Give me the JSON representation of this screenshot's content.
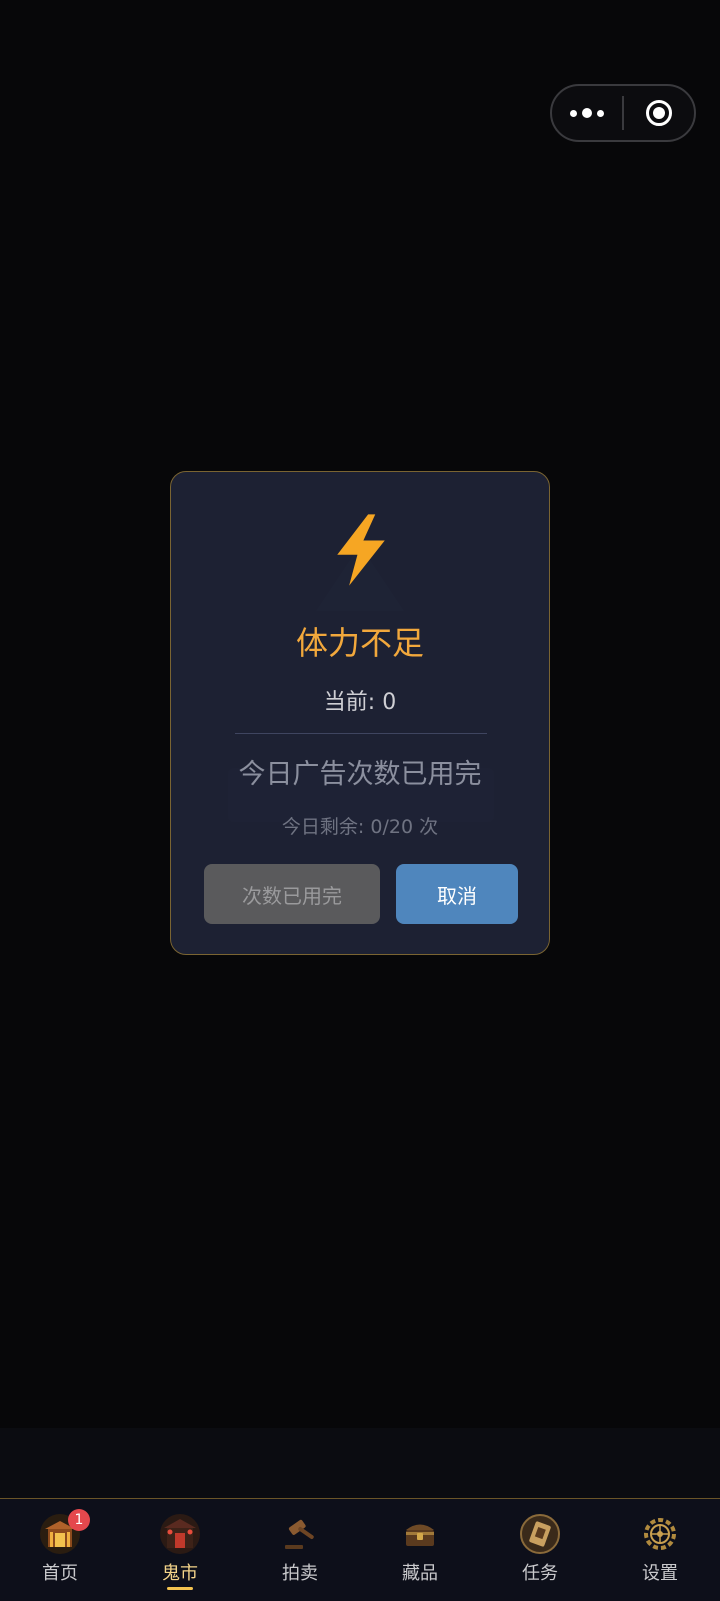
{
  "modal": {
    "title": "体力不足",
    "current": "当前: 0",
    "message": "今日广告次数已用完",
    "remaining": "今日剩余: 0/20 次",
    "used_button": "次数已用完",
    "cancel_button": "取消"
  },
  "tabs": [
    {
      "label": "首页",
      "icon": "gate-icon",
      "badge": "1"
    },
    {
      "label": "鬼市",
      "icon": "market-icon",
      "active": true
    },
    {
      "label": "拍卖",
      "icon": "gavel-icon"
    },
    {
      "label": "藏品",
      "icon": "chest-icon"
    },
    {
      "label": "任务",
      "icon": "scroll-icon"
    },
    {
      "label": "设置",
      "icon": "gear-icon"
    }
  ],
  "colors": {
    "accent": "#f2a83c",
    "cancel": "#4f86bd",
    "badge": "#e5484d",
    "active_tab": "#f4d48a"
  }
}
